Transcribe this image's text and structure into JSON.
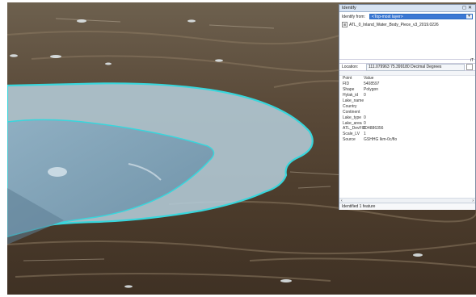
{
  "identify_window": {
    "title": "Identify",
    "controls": {
      "pin": "◻",
      "close": "✕"
    },
    "identify_from_label": "Identify from:",
    "identify_from_value": "<Top-most layer>",
    "tree_items": [
      {
        "expander": "⊞",
        "label": "ATL_0_Inland_Water_Body_Piece_v3_2019.0226"
      }
    ],
    "splitter_tag": "iT",
    "location_label": "Location:",
    "location_value": "111.079963  75.399180 Decimal Degrees",
    "fields": [
      {
        "name": "Point",
        "value": "Value"
      },
      {
        "name": "FID",
        "value": "5408597"
      },
      {
        "name": "Shape",
        "value": "Polygon"
      },
      {
        "name": "Hylak_id",
        "value": "0"
      },
      {
        "name": "Lake_name",
        "value": ""
      },
      {
        "name": "Country",
        "value": ""
      },
      {
        "name": "Continent",
        "value": ""
      },
      {
        "name": "Lake_type",
        "value": "0"
      },
      {
        "name": "Lake_area",
        "value": "0"
      },
      {
        "name": "ATL_DevFID",
        "value": "ID4886356"
      },
      {
        "name": "Scale_LV",
        "value": "1"
      },
      {
        "name": "Source",
        "value": "GSHHG lkm-0c/flo"
      }
    ],
    "scroll_left": "‹",
    "scroll_right": "›",
    "status_text": "Identified 1 feature"
  },
  "map": {
    "description_colors": {
      "terrain_dark": "#4a3a2a",
      "terrain_light": "#8c7a62",
      "lake_fill": "#b4ccd8",
      "lake_outline": "#38d6dc",
      "water": "#7e9fb4"
    }
  }
}
